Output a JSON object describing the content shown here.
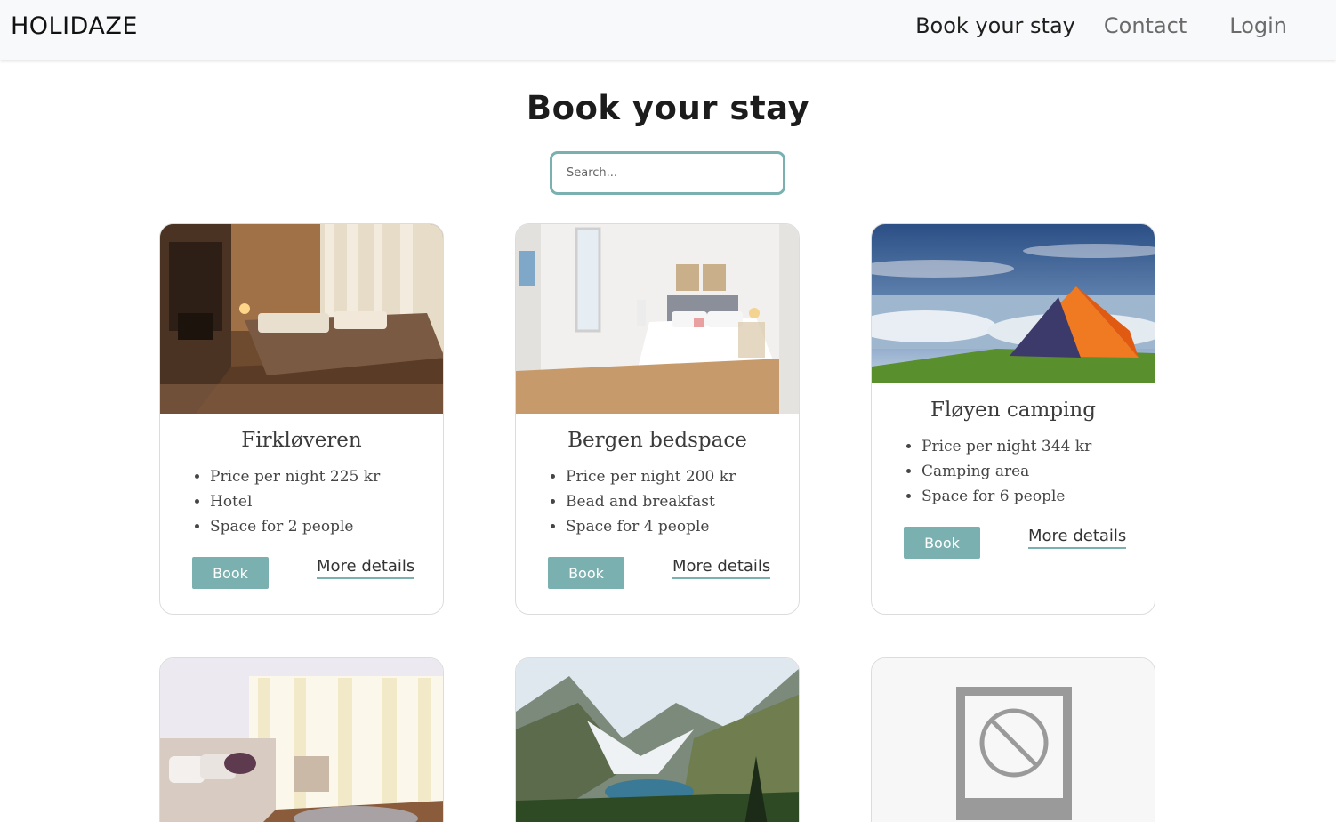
{
  "nav": {
    "logo": "HOLIDAZE",
    "links": [
      {
        "label": "Book your stay"
      },
      {
        "label": "Contact"
      },
      {
        "label": "Login"
      }
    ]
  },
  "page": {
    "title": "Book your stay",
    "search_placeholder": "Search..."
  },
  "cards": [
    {
      "title": "Firkløveren",
      "items": [
        "Price per night 225 kr",
        "Hotel",
        "Space for 2 people"
      ],
      "book_label": "Book",
      "details_label": "More details"
    },
    {
      "title": "Bergen bedspace",
      "items": [
        "Price per night 200 kr",
        "Bead and breakfast",
        "Space for 4 people"
      ],
      "book_label": "Book",
      "details_label": "More details"
    },
    {
      "title": "Fløyen camping",
      "items": [
        "Price per night 344 kr",
        "Camping area",
        "Space for 6 people"
      ],
      "book_label": "Book",
      "details_label": "More details"
    }
  ],
  "colors": {
    "accent": "#7ab1b0",
    "navbar_bg": "#f8f9fa"
  }
}
